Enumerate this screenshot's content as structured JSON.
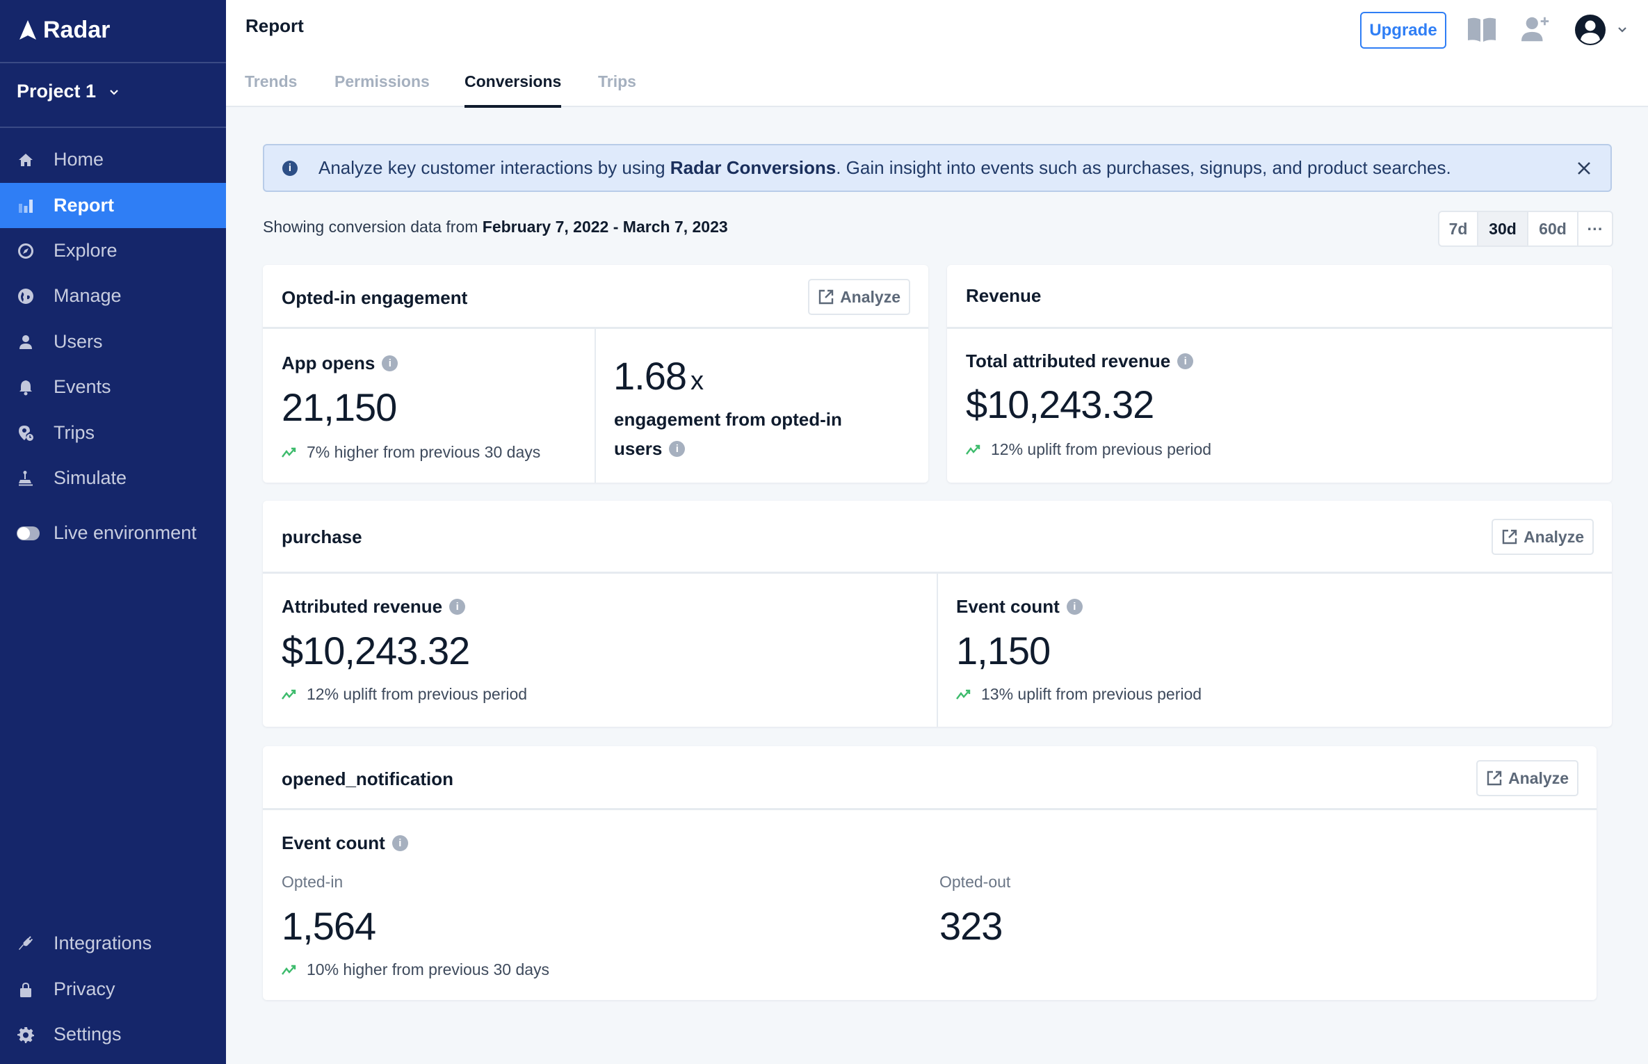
{
  "app": {
    "name": "Radar",
    "project": "Project 1"
  },
  "sidebar": {
    "items": [
      {
        "label": "Home",
        "icon": "home-icon"
      },
      {
        "label": "Report",
        "icon": "bar-chart-icon",
        "active": true
      },
      {
        "label": "Explore",
        "icon": "compass-icon"
      },
      {
        "label": "Manage",
        "icon": "globe-icon"
      },
      {
        "label": "Users",
        "icon": "user-icon"
      },
      {
        "label": "Events",
        "icon": "bell-icon"
      },
      {
        "label": "Trips",
        "icon": "map-pin-clock-icon"
      },
      {
        "label": "Simulate",
        "icon": "joystick-icon"
      }
    ],
    "live_environment": {
      "label": "Live environment",
      "enabled": false
    },
    "bottom_items": [
      {
        "label": "Integrations",
        "icon": "plug-icon"
      },
      {
        "label": "Privacy",
        "icon": "lock-icon"
      },
      {
        "label": "Settings",
        "icon": "gear-icon"
      }
    ]
  },
  "header": {
    "title": "Report",
    "tabs": [
      {
        "label": "Trends",
        "active": false
      },
      {
        "label": "Permissions",
        "active": false
      },
      {
        "label": "Conversions",
        "active": true
      },
      {
        "label": "Trips",
        "active": false
      }
    ],
    "upgrade_label": "Upgrade",
    "icons": [
      "book-icon",
      "add-user-icon",
      "account-avatar-icon",
      "chevron-down-icon"
    ]
  },
  "banner": {
    "prefix": "Analyze key customer interactions by using ",
    "highlight": "Radar Conversions",
    "suffix": ". Gain insight into events such as purchases, signups, and product searches."
  },
  "date_range": {
    "prefix": "Showing conversion data from ",
    "start": "February 7, 2022",
    "separator": " - ",
    "end": "March 7, 2023",
    "options": [
      "7d",
      "30d",
      "60d",
      "···"
    ],
    "selected": "30d"
  },
  "cards": {
    "engagement": {
      "title": "Opted-in engagement",
      "analyze_label": "Analyze",
      "app_opens": {
        "label": "App opens",
        "value": "21,150",
        "trend": "7% higher from previous 30 days"
      },
      "multiplier": {
        "value": "1.68",
        "suffix": "x",
        "label_line1": "engagement from opted-in",
        "label_line2": "users"
      }
    },
    "revenue": {
      "title": "Revenue",
      "metric": {
        "label": "Total attributed revenue",
        "value": "$10,243.32",
        "trend": "12% uplift from previous period"
      }
    },
    "purchase": {
      "title": "purchase",
      "analyze_label": "Analyze",
      "attributed_revenue": {
        "label": "Attributed revenue",
        "value": "$10,243.32",
        "trend": "12% uplift from previous period"
      },
      "event_count": {
        "label": "Event count",
        "value": "1,150",
        "trend": "13% uplift from previous period"
      }
    },
    "opened_notification": {
      "title": "opened_notification",
      "analyze_label": "Analyze",
      "event_count_label": "Event count",
      "opted_in": {
        "label": "Opted-in",
        "value": "1,564",
        "trend": "10% higher from previous 30 days"
      },
      "opted_out": {
        "label": "Opted-out",
        "value": "323"
      }
    }
  },
  "colors": {
    "sidebar_bg": "#15266a",
    "accent": "#2f7ef5",
    "trend_up": "#3dbb6c",
    "banner_bg": "#dfeafb"
  }
}
